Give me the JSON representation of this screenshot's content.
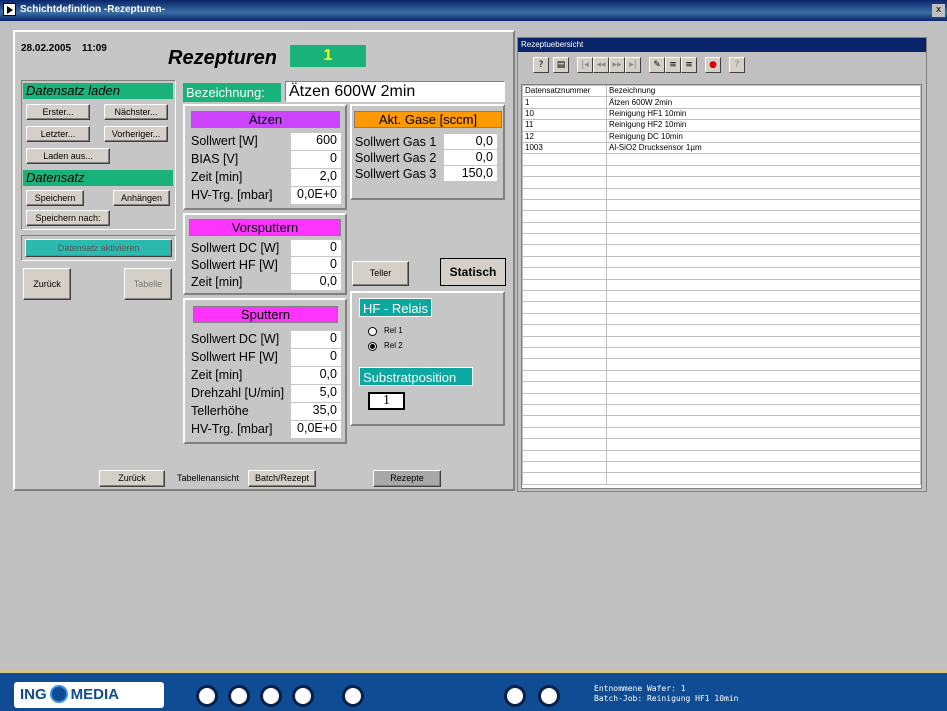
{
  "window": {
    "title": "Schichtdefinition -Rezepturen-",
    "close": "x"
  },
  "header": {
    "date": "28.02.2005",
    "time": "11:09",
    "title": "Rezepturen",
    "number": "1"
  },
  "datensatz_laden": {
    "heading": "Datensatz laden",
    "erster": "Erster...",
    "naechster": "Nächster...",
    "letzter": "Letzter...",
    "vorheriger": "Vorheriger...",
    "laden_aus": "Laden aus..."
  },
  "datensatz": {
    "heading": "Datensatz",
    "speichern": "Speichern",
    "anhaengen": "Anhängen",
    "speichern_nach": "Speichern nach:",
    "aktivieren": "Datensatz aktivieren",
    "zurueck": "Zurück",
    "tabelle": "Tabelle"
  },
  "bezeichnung": {
    "label": "Bezeichnung:",
    "value": "Ätzen 600W 2min"
  },
  "aetzen": {
    "heading": "Ätzen",
    "rows": [
      {
        "label": "Sollwert [W]",
        "value": "600"
      },
      {
        "label": "BIAS [V]",
        "value": "0"
      },
      {
        "label": "Zeit [min]",
        "value": "2,0"
      },
      {
        "label": "HV-Trg. [mbar]",
        "value": "0,0E+0"
      }
    ]
  },
  "gase": {
    "heading": "Akt. Gase [sccm]",
    "rows": [
      {
        "label": "Sollwert Gas 1",
        "value": "0,0"
      },
      {
        "label": "Sollwert Gas 2",
        "value": "0,0"
      },
      {
        "label": "Sollwert Gas 3",
        "value": "150,0"
      }
    ]
  },
  "vorsputtern": {
    "heading": "Vorsputtern",
    "rows": [
      {
        "label": "Sollwert DC [W]",
        "value": "0"
      },
      {
        "label": "Sollwert HF [W]",
        "value": "0"
      },
      {
        "label": "Zeit [min]",
        "value": "0,0"
      }
    ]
  },
  "sputtern": {
    "heading": "Sputtern",
    "rows": [
      {
        "label": "Sollwert DC [W]",
        "value": "0"
      },
      {
        "label": "Sollwert HF [W]",
        "value": "0"
      },
      {
        "label": "Zeit [min]",
        "value": "0,0"
      },
      {
        "label": "Drehzahl [U/min]",
        "value": "5,0"
      },
      {
        "label": "Tellerhöhe",
        "value": "35,0"
      },
      {
        "label": "HV-Trg. [mbar]",
        "value": "0,0E+0"
      }
    ]
  },
  "teller": {
    "button": "Teller",
    "status": "Statisch"
  },
  "hf_relais": {
    "heading": "HF - Relais",
    "rel1": "Rel 1",
    "rel2": "Rel 2",
    "selected": "Rel 2"
  },
  "substrat": {
    "heading": "Substratposition",
    "value": "1"
  },
  "bottom": {
    "zurueck": "Zurück",
    "tabellenansicht": "Tabellenansicht",
    "batch": "Batch/Rezept",
    "rezepte": "Rezepte"
  },
  "overview": {
    "title": "Rezeptuebersicht",
    "columns": [
      "Datensatznummer",
      "Bezeichnung"
    ],
    "rows": [
      [
        "1",
        "Ätzen 600W 2min"
      ],
      [
        "10",
        "Reinigung HF1 10min"
      ],
      [
        "11",
        "Reinigung HF2 10min"
      ],
      [
        "12",
        "Reinigung DC 10min"
      ],
      [
        "1003",
        "Al-SiO2 Drucksensor 1µm"
      ]
    ]
  },
  "footer": {
    "logo_left": "ING",
    "logo_right": "MEDIA",
    "status1": "Entnommene Wafer: 1",
    "status2": "Batch-Job: Reinigung HF1 10min"
  },
  "colors": {
    "accent_green": "#19b27a",
    "teal": "#0ca8a0",
    "magenta": "#ff33ff",
    "orange": "#ff9900",
    "titlebar": "#0a246a",
    "footer": "#0f4c93"
  }
}
